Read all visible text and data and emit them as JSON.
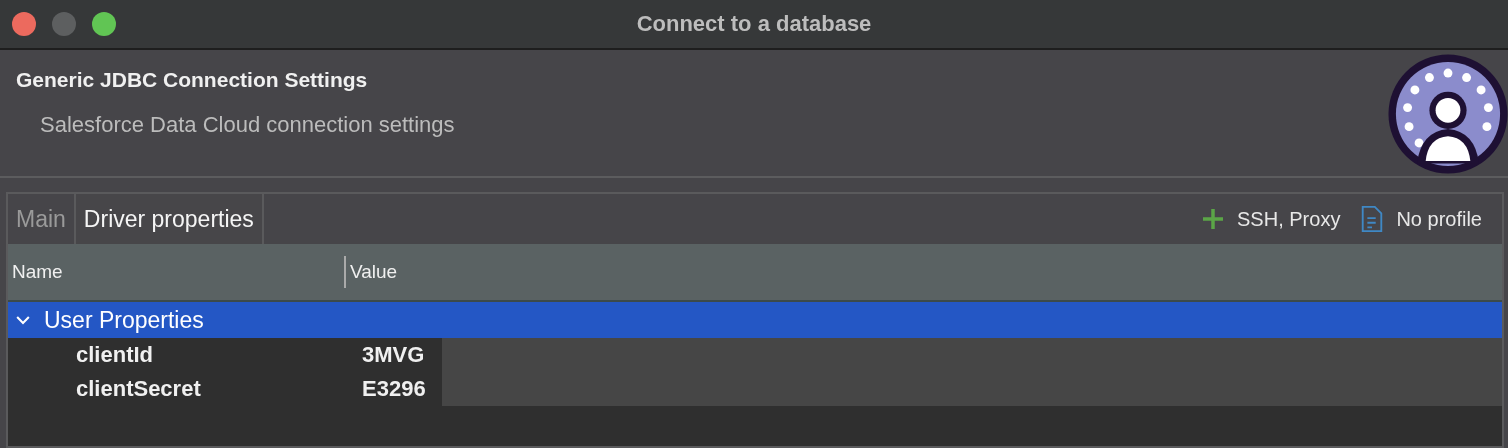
{
  "window": {
    "title": "Connect to a database"
  },
  "header": {
    "title": "Generic JDBC Connection Settings",
    "subtitle": "Salesforce Data Cloud connection settings"
  },
  "tabs": [
    {
      "label": "Main",
      "selected": false
    },
    {
      "label": "Driver properties",
      "selected": true
    }
  ],
  "toolbar": [
    {
      "kind": "add",
      "label": "SSH, Proxy"
    },
    {
      "kind": "document",
      "label": "No profile"
    }
  ],
  "table": {
    "columns": [
      "Name",
      "Value"
    ],
    "groups": [
      {
        "label": "User Properties",
        "expanded": true,
        "selected": true,
        "rows": [
          {
            "name": "clientId",
            "value": "3MVG"
          },
          {
            "name": "clientSecret",
            "value": "E3296"
          }
        ]
      }
    ]
  }
}
